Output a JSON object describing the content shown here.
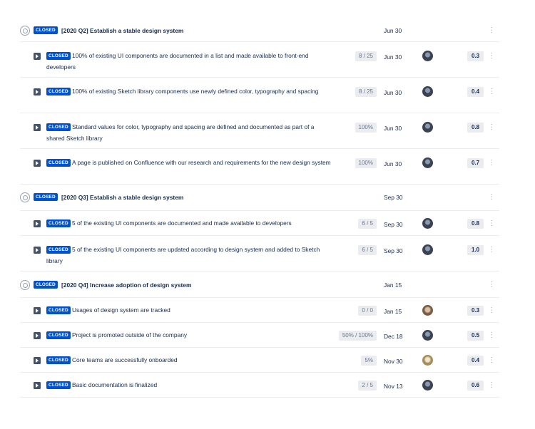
{
  "status_label": "CLOSED",
  "objectives": [
    {
      "title": "[2020 Q2] Establish a stable design system",
      "date": "Jun 30",
      "key_results": [
        {
          "text": "100% of existing UI components are documented in a list and made available to front-end developers",
          "progress": "8 / 25",
          "date": "Jun 30",
          "score": "0.3"
        },
        {
          "text": "100% of existing Sketch library components use newly defined color, typography and spacing",
          "progress": "8 / 25",
          "date": "Jun 30",
          "score": "0.4"
        },
        {
          "text": "Standard values for color, typography and spacing are defined and documented as part of a shared Sketch library",
          "progress": "100%",
          "date": "Jun 30",
          "score": "0.8"
        },
        {
          "text": "A page is published on Confluence with our research and requirements for the new design system",
          "progress": "100%",
          "date": "Jun 30",
          "score": "0.7"
        }
      ]
    },
    {
      "title": "[2020 Q3] Establish a stable design system",
      "date": "Sep 30",
      "key_results": [
        {
          "text": "5 of the existing UI components are documented and made available to developers",
          "progress": "6 / 5",
          "date": "Sep 30",
          "score": "0.8"
        },
        {
          "text": "5 of the existing UI components are updated according to design system and added to Sketch library",
          "progress": "6 / 5",
          "date": "Sep 30",
          "score": "1.0"
        }
      ]
    },
    {
      "title": "[2020 Q4] Increase adoption of design system",
      "date": "Jan 15",
      "key_results": [
        {
          "text": "Usages of design system are tracked",
          "progress": "0 / 0",
          "date": "Jan 15",
          "score": "0.3"
        },
        {
          "text": "Project is promoted outside of the company",
          "progress": "50% / 100%",
          "date": "Dec 18",
          "score": "0.5"
        },
        {
          "text": "Core teams are successfully onboarded",
          "progress": "5%",
          "date": "Nov 30",
          "score": "0.4"
        },
        {
          "text": "Basic documentation is finalized",
          "progress": "2 / 5",
          "date": "Nov 13",
          "score": "0.6"
        }
      ]
    }
  ],
  "icons": {
    "objective": "target-icon",
    "key_result": "flag-icon",
    "menu": "more-vertical-icon",
    "owner": "avatar"
  },
  "colors": {
    "badge_bg": "#0052cc",
    "badge_text": "#ffffff",
    "chip_bg": "#ebecf0",
    "text": "#172b4d",
    "muted": "#6b778c"
  }
}
